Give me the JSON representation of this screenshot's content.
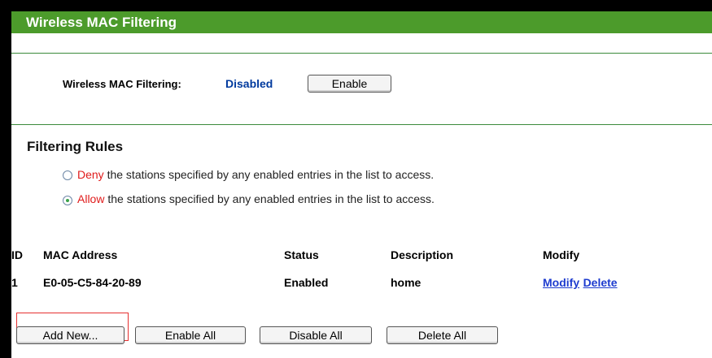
{
  "title": "Wireless MAC Filtering",
  "filter_status": {
    "label": "Wireless MAC Filtering:",
    "value": "Disabled",
    "button": "Enable"
  },
  "rules": {
    "heading": "Filtering Rules",
    "options": [
      {
        "keyword": "Deny",
        "text": " the stations specified by any enabled entries in the list to access.",
        "selected": false
      },
      {
        "keyword": "Allow",
        "text": " the stations specified by any enabled entries in the list to access.",
        "selected": true
      }
    ]
  },
  "table": {
    "headers": [
      "ID",
      "MAC Address",
      "Status",
      "Description",
      "Modify"
    ],
    "rows": [
      {
        "id": "1",
        "mac": "E0-05-C5-84-20-89",
        "status": "Enabled",
        "description": "home",
        "modify": "Modify",
        "delete": "Delete"
      }
    ]
  },
  "actions": {
    "add_new": "Add New...",
    "enable_all": "Enable All",
    "disable_all": "Disable All",
    "delete_all": "Delete All"
  },
  "colors": {
    "titlebar": "#4c9b2b",
    "status_value": "#003a9e",
    "keyword": "#e01b1b",
    "link": "#1e3ccf",
    "highlight": "#e53030"
  }
}
